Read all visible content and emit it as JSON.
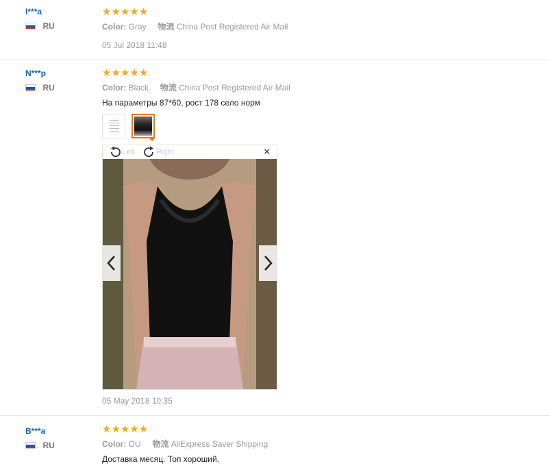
{
  "reviews": [
    {
      "user": "I***a",
      "country": "RU",
      "stars": "★★★★★",
      "color_key": "Color:",
      "color": "Gray",
      "shipping_key": "物流",
      "shipping": "China Post Registered Air Mail",
      "date": "05 Jul 2018 11:48"
    },
    {
      "user": "N***p",
      "country": "RU",
      "stars": "★★★★★",
      "color_key": "Color:",
      "color": "Black",
      "shipping_key": "物流",
      "shipping": "China Post Registered Air Mail",
      "text": "На параметры 87*60, рост 178 село норм",
      "date": "05 May 2018 10:35",
      "viewer": {
        "rotate_left": "Left",
        "rotate_right": "Right",
        "close": "×"
      }
    },
    {
      "user": "B***a",
      "country": "RU",
      "stars": "★★★★★",
      "color_key": "Color:",
      "color": "OU",
      "shipping_key": "物流",
      "shipping": "AliExpress Saver Shipping",
      "text": "Доставка месяц. Топ хороший."
    }
  ],
  "colors": {
    "star": "#f5a623",
    "username": "#1a5fb4",
    "accent": "#e87722"
  },
  "icons": [
    "flag-ru-icon",
    "rotate-left-icon",
    "rotate-right-icon",
    "close-icon",
    "chevron-left-icon",
    "chevron-right-icon"
  ]
}
